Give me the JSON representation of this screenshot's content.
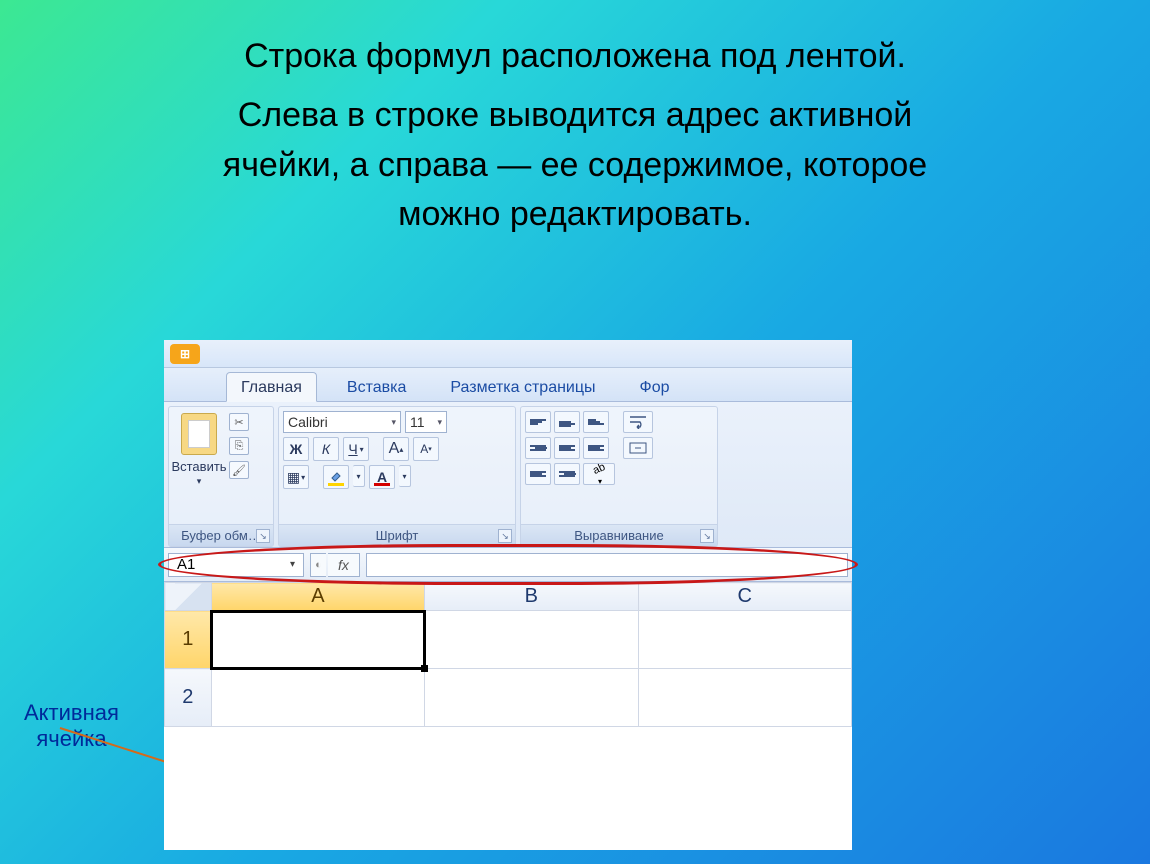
{
  "slide": {
    "line1": "Строка формул расположена под лентой.",
    "para": "Слева в строке выводится адрес активной ячейки, а справа — ее содержимое, которое можно редактировать."
  },
  "callout": {
    "line1": "Активная",
    "line2": "ячейка"
  },
  "ribbon": {
    "tabs": {
      "home": "Главная",
      "insert": "Вставка",
      "layout": "Разметка страницы",
      "formulas": "Фор"
    },
    "clipboard": {
      "paste": "Вставить",
      "group_label": "Буфер обм…"
    },
    "font": {
      "name": "Calibri",
      "size": "11",
      "bold": "Ж",
      "italic": "К",
      "underline": "Ч",
      "grow": "А",
      "shrink": "А",
      "color_a": "А",
      "group_label": "Шрифт"
    },
    "align": {
      "group_label": "Выравнивание"
    }
  },
  "formula_bar": {
    "name_box": "A1",
    "fx": "fx"
  },
  "grid": {
    "columns": [
      "A",
      "B",
      "C"
    ],
    "rows": [
      "1",
      "2"
    ],
    "active_col": 0,
    "active_row": 0
  }
}
